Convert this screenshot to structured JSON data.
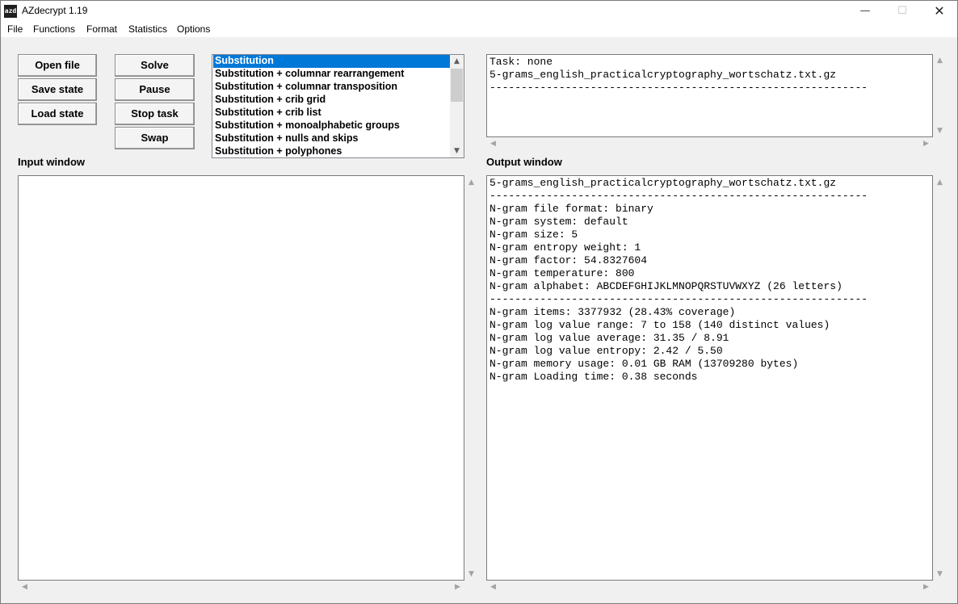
{
  "window": {
    "title": "AZdecrypt 1.19",
    "icon_text": "azd",
    "controls": {
      "minimize": "—",
      "maximize": "☐",
      "close": "✕"
    }
  },
  "menu": [
    "File",
    "Functions",
    "Format",
    "Statistics",
    "Options"
  ],
  "buttons": {
    "open_file": "Open file",
    "save_state": "Save state",
    "load_state": "Load state",
    "solve": "Solve",
    "pause": "Pause",
    "stop_task": "Stop task",
    "swap": "Swap"
  },
  "solver_list": {
    "selected": "Substitution",
    "items": [
      "Substitution",
      "Substitution + columnar rearrangement",
      "Substitution + columnar transposition",
      "Substitution + crib grid",
      "Substitution + crib list",
      "Substitution + monoalphabetic groups",
      "Substitution + nulls and skips",
      "Substitution + polyphones"
    ]
  },
  "task_box": {
    "lines": [
      "Task: none",
      "5-grams_english_practicalcryptography_wortschatz.txt.gz",
      "------------------------------------------------------------"
    ]
  },
  "labels": {
    "input_window": "Input window",
    "output_window": "Output window"
  },
  "input_box": {
    "value": ""
  },
  "output_box": {
    "lines": [
      "5-grams_english_practicalcryptography_wortschatz.txt.gz",
      "------------------------------------------------------------",
      "N-gram file format: binary",
      "N-gram system: default",
      "N-gram size: 5",
      "N-gram entropy weight: 1",
      "N-gram factor: 54.8327604",
      "N-gram temperature: 800",
      "N-gram alphabet: ABCDEFGHIJKLMNOPQRSTUVWXYZ (26 letters)",
      "------------------------------------------------------------",
      "N-gram items: 3377932 (28.43% coverage)",
      "N-gram log value range: 7 to 158 (140 distinct values)",
      "N-gram log value average: 31.35 / 8.91",
      "N-gram log value entropy: 2.42 / 5.50",
      "N-gram memory usage: 0.01 GB RAM (13709280 bytes)",
      "N-gram Loading time: 0.38 seconds"
    ]
  },
  "scroll_arrows": {
    "up": "▲",
    "down": "▼",
    "left": "◀",
    "right": "▶"
  }
}
